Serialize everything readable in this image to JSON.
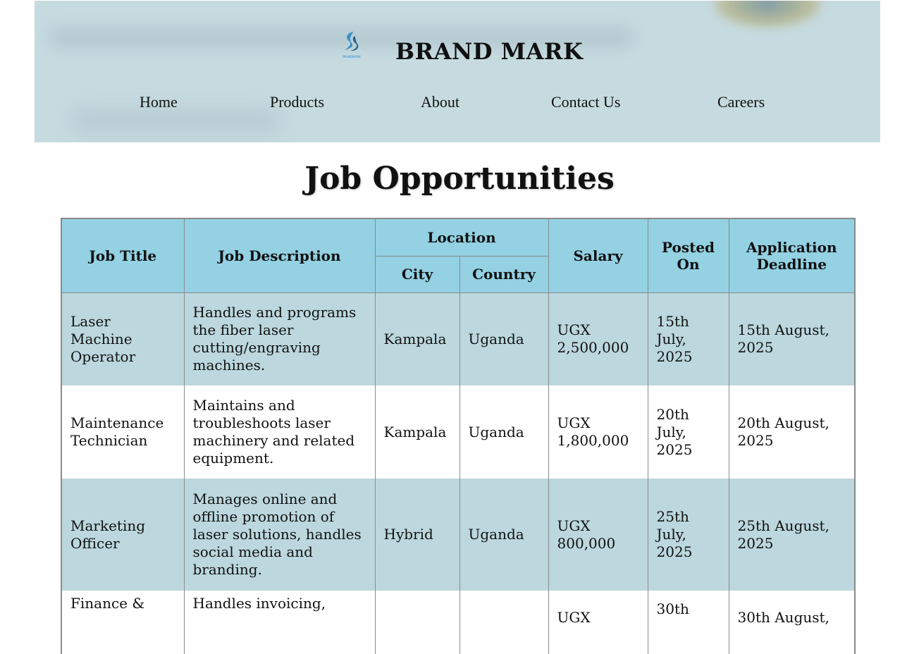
{
  "brand": {
    "name": "BRAND MARK",
    "logo_text": "BRANDMARK"
  },
  "nav": {
    "items": [
      "Home",
      "Products",
      "About",
      "Contact Us",
      "Careers"
    ]
  },
  "page": {
    "title": "Job Opportunities"
  },
  "table": {
    "headers": {
      "job_title": "Job Title",
      "job_description": "Job Description",
      "location": "Location",
      "city": "City",
      "country": "Country",
      "salary": "Salary",
      "posted_on": "Posted On",
      "deadline": "Application Deadline"
    },
    "rows": [
      {
        "title": "Laser Machine Operator",
        "description": "Handles and programs the fiber laser cutting/engraving machines.",
        "city": "Kampala",
        "country": "Uganda",
        "salary": "UGX 2,500,000",
        "posted": "15th July, 2025",
        "deadline": "15th August, 2025"
      },
      {
        "title": "Maintenance Technician",
        "description": "Maintains and troubleshoots laser machinery and related equipment.",
        "city": "Kampala",
        "country": "Uganda",
        "salary": "UGX 1,800,000",
        "posted": "20th July, 2025",
        "deadline": "20th August, 2025"
      },
      {
        "title": "Marketing Officer",
        "description": "Manages online and offline promotion of laser solutions, handles social media and branding.",
        "city": "Hybrid",
        "country": "Uganda",
        "salary": "UGX 800,000",
        "posted": "25th July, 2025",
        "deadline": "25th August, 2025"
      },
      {
        "title": "Finance &",
        "description": "Handles invoicing,",
        "city": "",
        "country": "",
        "salary": "UGX",
        "posted": "30th",
        "deadline": "30th August,"
      }
    ]
  },
  "colors": {
    "header_bg": "#c6dbe0",
    "table_header_bg": "#93d1e3",
    "row_odd_bg": "#bcd7de",
    "row_even_bg": "#ffffff",
    "logo_blue": "#2a8fd6"
  }
}
